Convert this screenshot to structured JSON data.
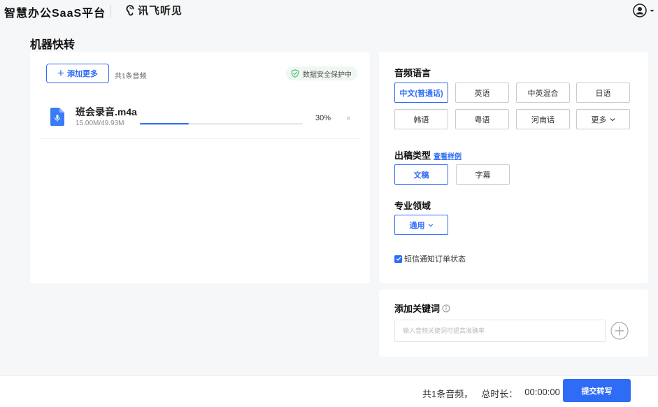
{
  "header": {
    "brand": "智慧办公SaaS平台",
    "logo_text": "讯飞听见"
  },
  "page_title": "机器快转",
  "upload": {
    "add_more_label": "添加更多",
    "count_text": "共1条音频",
    "secure_text": "数据安全保护中",
    "file": {
      "name": "班会录音.m4a",
      "size": "15.00M/49.93M",
      "progress_pct": "30%",
      "progress": 0.3,
      "remove": "×"
    }
  },
  "settings": {
    "language_title": "音频语言",
    "languages": [
      {
        "label": "中文(普通话)",
        "selected": true
      },
      {
        "label": "英语",
        "selected": false
      },
      {
        "label": "中英混合",
        "selected": false
      },
      {
        "label": "日语",
        "selected": false
      },
      {
        "label": "韩语",
        "selected": false
      },
      {
        "label": "粤语",
        "selected": false
      },
      {
        "label": "河南话",
        "selected": false
      },
      {
        "label": "更多",
        "selected": false
      }
    ],
    "output_title": "出稿类型",
    "view_sample": "查看样例",
    "outputs": [
      {
        "label": "文稿",
        "selected": true
      },
      {
        "label": "字幕",
        "selected": false
      }
    ],
    "domain_title": "专业领域",
    "domain_value": "通用",
    "sms_label": "短信通知订单状态",
    "sms_checked": true
  },
  "keywords": {
    "title": "添加关键词",
    "placeholder": "输入音频关键词可提高准确率"
  },
  "footer": {
    "count": "共1条音频，",
    "duration_label": "总时长：",
    "duration": "00:00:00",
    "submit_label": "提交转写"
  },
  "colors": {
    "accent": "#2f6cf6",
    "secure_bg": "#eef8f1",
    "secure_icon": "#3dbb6c"
  }
}
